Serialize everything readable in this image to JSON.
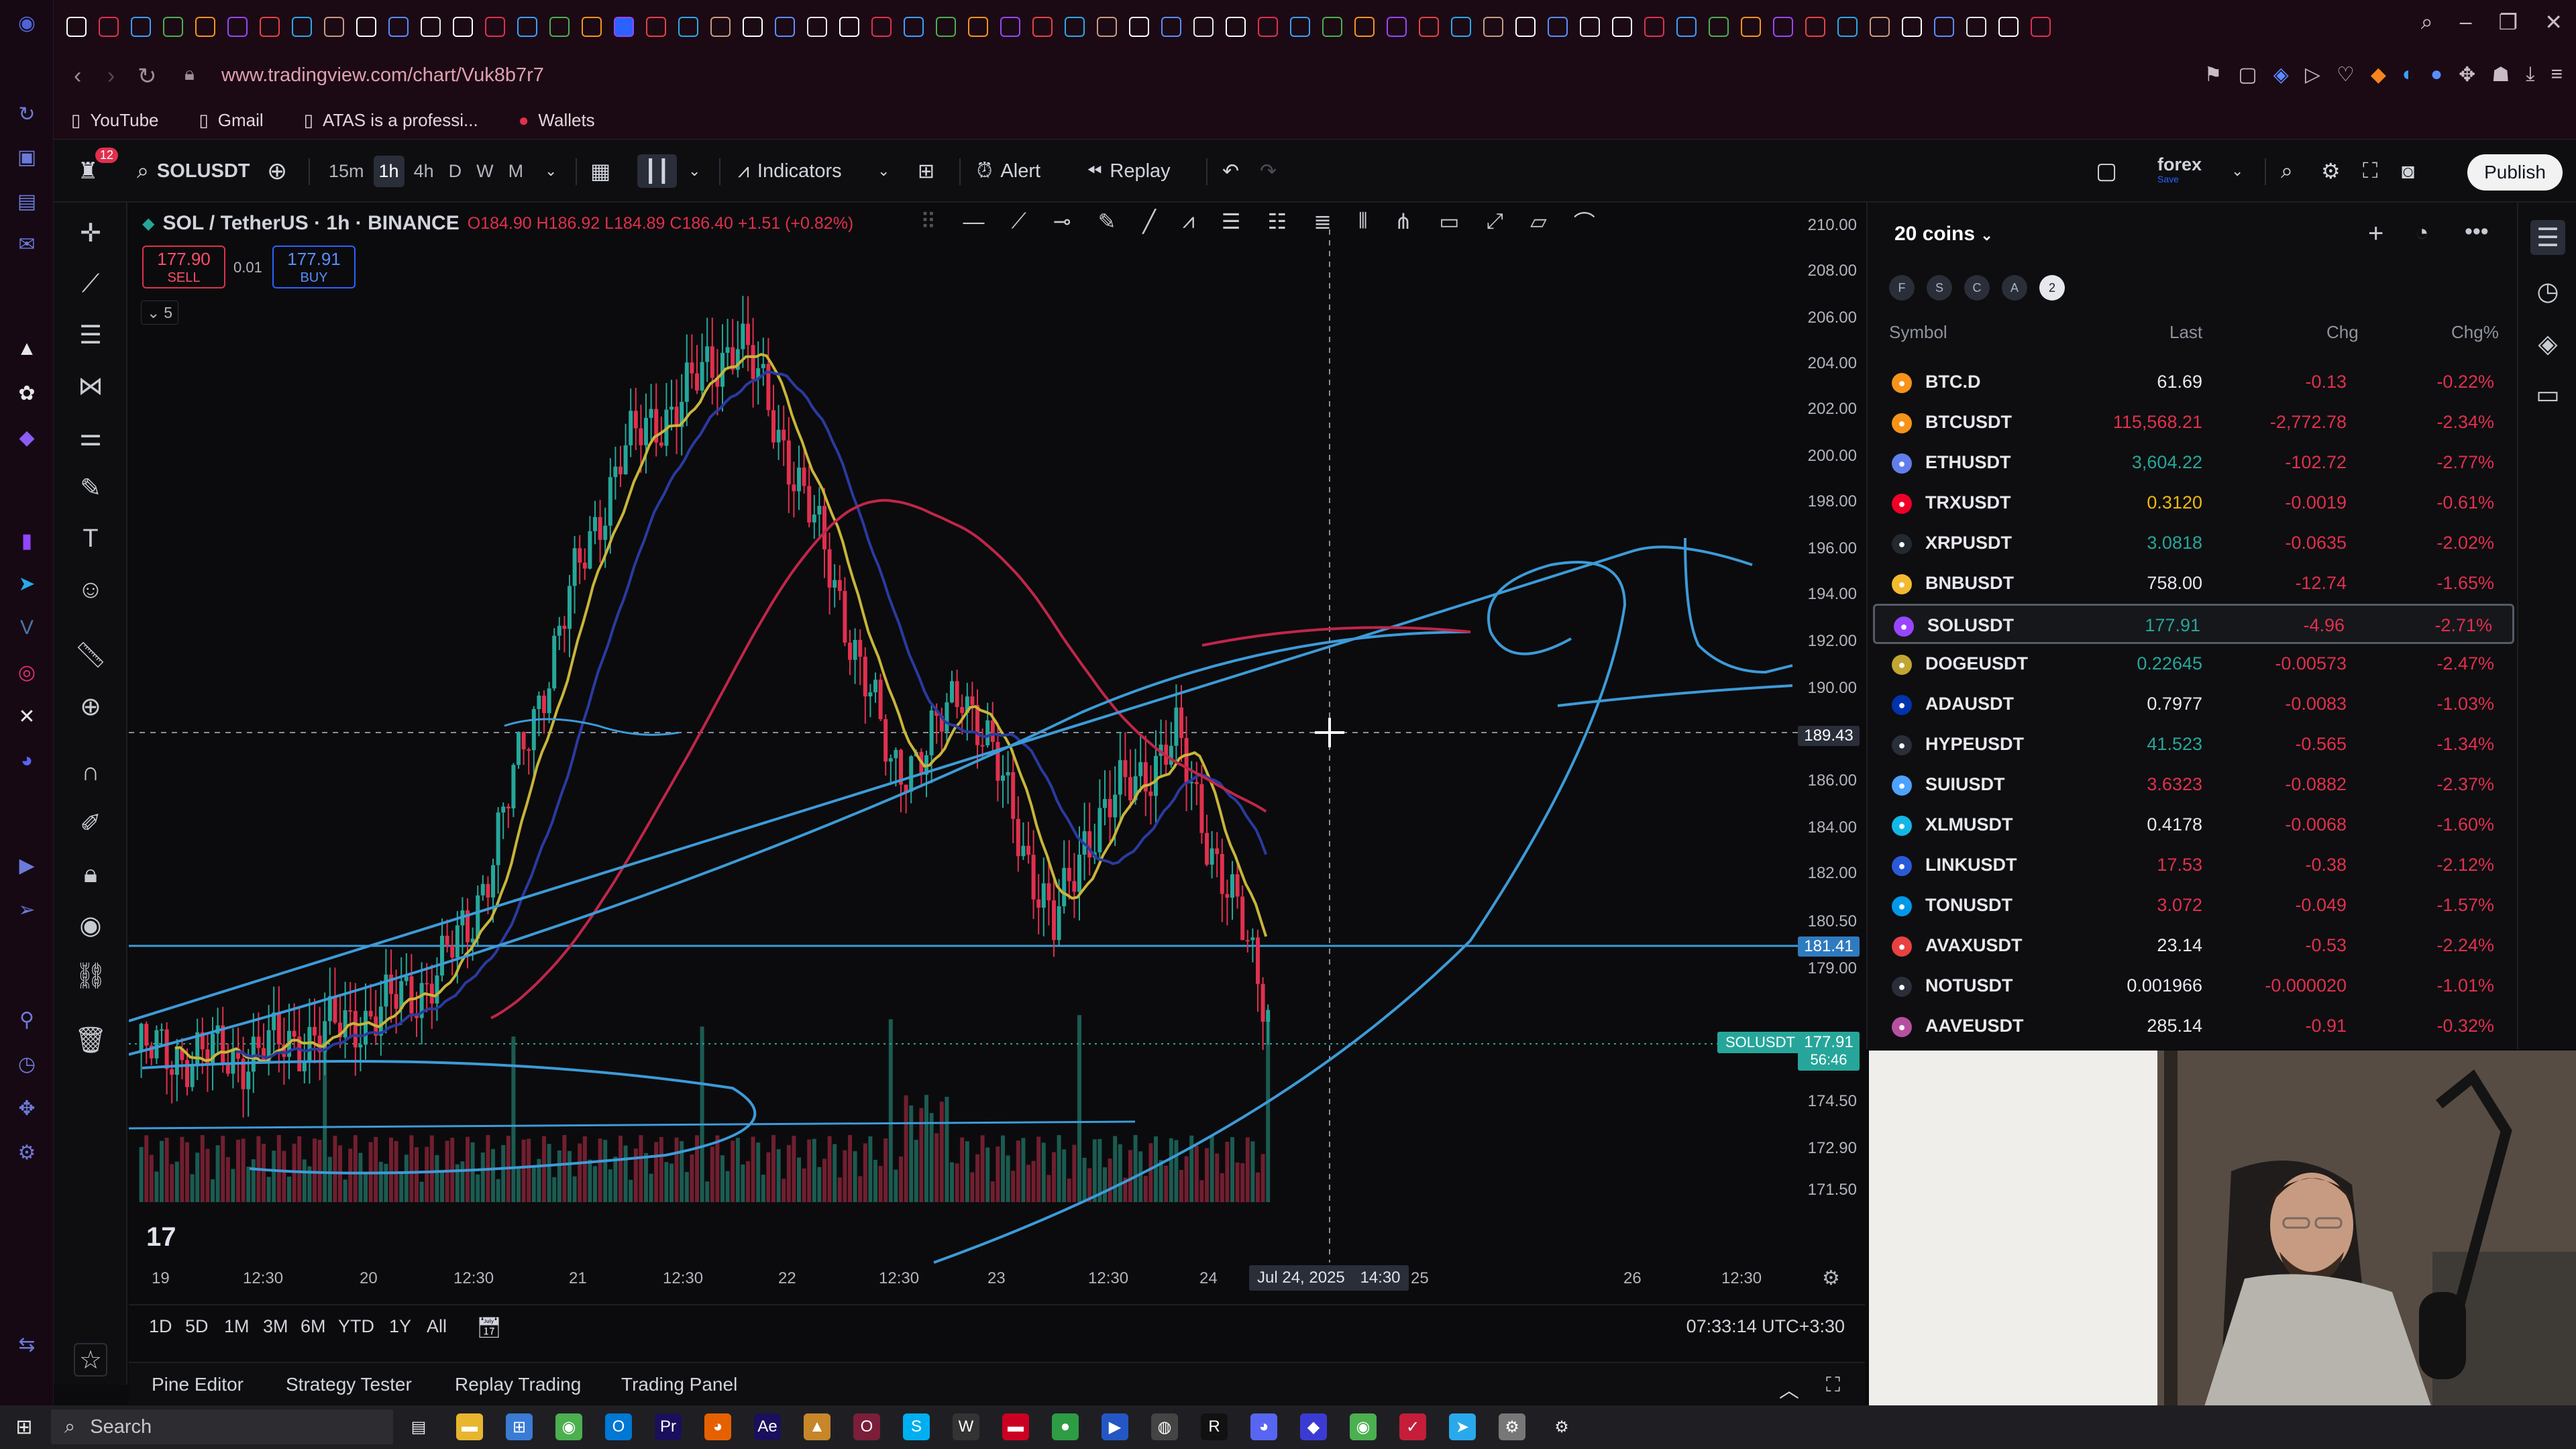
{
  "browser": {
    "url": "www.tradingview.com/chart/Vuk8b7r7",
    "bookmarks": [
      {
        "label": "YouTube",
        "icon": "page-icon"
      },
      {
        "label": "Gmail",
        "icon": "page-icon"
      },
      {
        "label": "ATAS is a professi...",
        "icon": "page-icon"
      },
      {
        "label": "Wallets",
        "icon": "wallet-icon"
      }
    ]
  },
  "toolbar": {
    "notification_count": "12",
    "symbol": "SOLUSDT",
    "timeframes": [
      "15m",
      "1h",
      "4h",
      "D",
      "W",
      "M"
    ],
    "active_timeframe": "1h",
    "indicators_label": "Indicators",
    "alert_label": "Alert",
    "replay_label": "Replay",
    "layout_name": "forex",
    "layout_status": "Save",
    "publish_label": "Publish"
  },
  "legend": {
    "title": "SOL / TetherUS · 1h · BINANCE",
    "open": "O184.90",
    "high": "H186.92",
    "low": "L184.89",
    "close": "C186.40",
    "change": "+1.51 (+0.82%)",
    "sell_price": "177.90",
    "sell_label": "SELL",
    "buy_price": "177.91",
    "buy_label": "BUY",
    "spread": "0.01",
    "collapsed_count": "5"
  },
  "price_axis": {
    "labels": [
      "210.00",
      "208.00",
      "206.00",
      "204.00",
      "202.00",
      "200.00",
      "198.00",
      "196.00",
      "194.00",
      "192.00",
      "190.00",
      "188.00",
      "186.00",
      "184.00",
      "182.00",
      "180.50",
      "179.00",
      "176.00",
      "174.50",
      "172.90",
      "171.50"
    ],
    "crosshair_price": "189.43",
    "line_price": "181.41",
    "current_symbol": "SOLUSDT",
    "current_price": "177.91",
    "countdown": "56:46"
  },
  "time_axis": {
    "labels": [
      "19",
      "12:30",
      "20",
      "12:30",
      "21",
      "12:30",
      "22",
      "12:30",
      "23",
      "12:30",
      "24",
      "12:30",
      "26",
      "12:30"
    ],
    "crosshair_date": "Jul 24, 2025",
    "crosshair_time": "14:30",
    "partial_label": "25"
  },
  "range_bar": {
    "ranges": [
      "1D",
      "5D",
      "1M",
      "3M",
      "6M",
      "YTD",
      "1Y",
      "All"
    ],
    "clock": "07:33:14 UTC+3:30"
  },
  "bottom_tabs": [
    "Pine Editor",
    "Strategy Tester",
    "Replay Trading",
    "Trading Panel"
  ],
  "watchlist": {
    "title": "20 coins",
    "flags": [
      "F",
      "S",
      "C",
      "A",
      "2"
    ],
    "headers": {
      "symbol": "Symbol",
      "last": "Last",
      "chg": "Chg",
      "chg_pct": "Chg%"
    },
    "rows": [
      {
        "symbol": "BTC.D",
        "last": "61.69",
        "chg": "-0.13",
        "pct": "-0.22%",
        "color": "#f7931a",
        "last_color": "#e6e8ee"
      },
      {
        "symbol": "BTCUSDT",
        "last": "115,568.21",
        "chg": "-2,772.78",
        "pct": "-2.34%",
        "color": "#f7931a",
        "last_color": "#e0304e"
      },
      {
        "symbol": "ETHUSDT",
        "last": "3,604.22",
        "chg": "-102.72",
        "pct": "-2.77%",
        "color": "#627eea",
        "last_color": "#26a69a"
      },
      {
        "symbol": "TRXUSDT",
        "last": "0.3120",
        "chg": "-0.0019",
        "pct": "-0.61%",
        "color": "#ef0027",
        "last_color": "#f0b90b"
      },
      {
        "symbol": "XRPUSDT",
        "last": "3.0818",
        "chg": "-0.0635",
        "pct": "-2.02%",
        "color": "#23292f",
        "last_color": "#26a69a"
      },
      {
        "symbol": "BNBUSDT",
        "last": "758.00",
        "chg": "-12.74",
        "pct": "-1.65%",
        "color": "#f3ba2f",
        "last_color": "#e6e8ee"
      },
      {
        "symbol": "SOLUSDT",
        "last": "177.91",
        "chg": "-4.96",
        "pct": "-2.71%",
        "color": "#9945ff",
        "last_color": "#26a69a"
      },
      {
        "symbol": "DOGEUSDT",
        "last": "0.22645",
        "chg": "-0.00573",
        "pct": "-2.47%",
        "color": "#c2a633",
        "last_color": "#26a69a"
      },
      {
        "symbol": "ADAUSDT",
        "last": "0.7977",
        "chg": "-0.0083",
        "pct": "-1.03%",
        "color": "#0033ad",
        "last_color": "#e6e8ee"
      },
      {
        "symbol": "HYPEUSDT",
        "last": "41.523",
        "chg": "-0.565",
        "pct": "-1.34%",
        "color": "#2a2e39",
        "last_color": "#26a69a"
      },
      {
        "symbol": "SUIUSDT",
        "last": "3.6323",
        "chg": "-0.0882",
        "pct": "-2.37%",
        "color": "#4da2ff",
        "last_color": "#e0304e"
      },
      {
        "symbol": "XLMUSDT",
        "last": "0.4178",
        "chg": "-0.0068",
        "pct": "-1.60%",
        "color": "#14b6e7",
        "last_color": "#e6e8ee"
      },
      {
        "symbol": "LINKUSDT",
        "last": "17.53",
        "chg": "-0.38",
        "pct": "-2.12%",
        "color": "#2a5ada",
        "last_color": "#e0304e"
      },
      {
        "symbol": "TONUSDT",
        "last": "3.072",
        "chg": "-0.049",
        "pct": "-1.57%",
        "color": "#0098ea",
        "last_color": "#e0304e"
      },
      {
        "symbol": "AVAXUSDT",
        "last": "23.14",
        "chg": "-0.53",
        "pct": "-2.24%",
        "color": "#e84142",
        "last_color": "#e6e8ee"
      },
      {
        "symbol": "NOTUSDT",
        "last": "0.001966",
        "chg": "-0.000020",
        "pct": "-1.01%",
        "color": "#2a2e39",
        "last_color": "#e6e8ee"
      },
      {
        "symbol": "AAVEUSDT",
        "last": "285.14",
        "chg": "-0.91",
        "pct": "-0.32%",
        "color": "#b6509e",
        "last_color": "#e6e8ee"
      }
    ],
    "selected_symbol": "SOLUSDT"
  },
  "taskbar": {
    "search_placeholder": "Search"
  },
  "colors": {
    "up": "#26a69a",
    "down": "#e0304e",
    "drawing": "#3d9bd8",
    "ma_fast": "#c8b53a",
    "ma_slow": "#c0264a",
    "ma_mid": "#2a3aa0"
  }
}
